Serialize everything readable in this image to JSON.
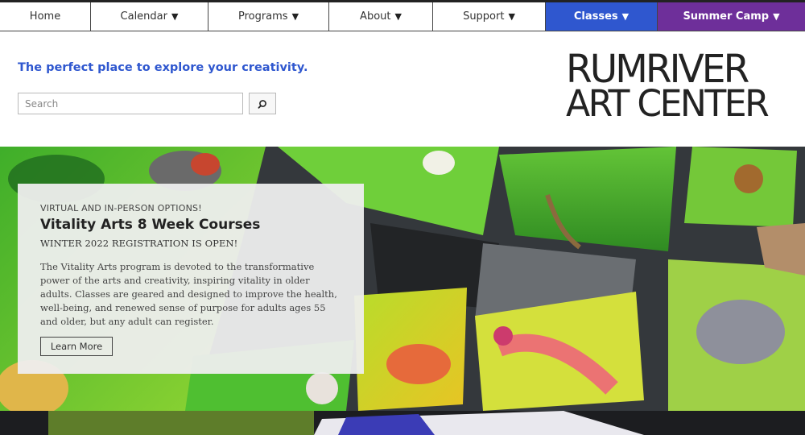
{
  "nav": {
    "items": [
      {
        "label": "Home",
        "arrow": ""
      },
      {
        "label": "Calendar",
        "arrow": "▼"
      },
      {
        "label": "Programs",
        "arrow": "▼"
      },
      {
        "label": "About",
        "arrow": "▼"
      },
      {
        "label": "Support",
        "arrow": "▼"
      },
      {
        "label": "Classes",
        "arrow": "▼"
      },
      {
        "label": "Summer Camp",
        "arrow": "▼"
      }
    ],
    "accent_classes": "#2f57cf",
    "accent_camp": "#6e2f9a"
  },
  "header": {
    "tagline": "The perfect place to explore your creativity.",
    "search_placeholder": "Search",
    "search_icon": "search-icon",
    "logo_line1": "RUMRIVER",
    "logo_line2": "ART CENTER"
  },
  "hero": {
    "eyebrow": "VIRTUAL AND IN-PERSON OPTIONS!",
    "title": "Vitality Arts 8 Week Courses",
    "subtitle": "WINTER 2022 REGISTRATION IS OPEN!",
    "body": "The Vitality Arts program is devoted to the transformative power of the arts and creativity, inspiring vitality in older adults. Classes are geared and designed to improve the health, well-being, and renewed sense of purpose for adults ages 55 and older, but any adult can register.",
    "button_label": "Learn More"
  }
}
